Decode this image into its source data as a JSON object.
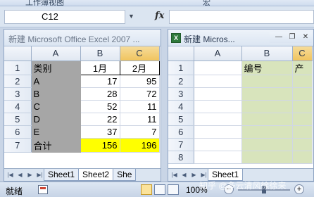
{
  "ribbon": {
    "group1": "工作簿视图",
    "group2": "宏"
  },
  "formula_bar": {
    "name_box": "C12",
    "fx": "fx"
  },
  "window_left": {
    "title": "新建 Microsoft Office Excel 2007 ...",
    "col_a": "A",
    "col_b": "B",
    "col_c": "C",
    "rows": [
      {
        "n": "1",
        "a": "类别",
        "b": "1月",
        "c": "2月"
      },
      {
        "n": "2",
        "a": "A",
        "b": "17",
        "c": "95"
      },
      {
        "n": "3",
        "a": "B",
        "b": "28",
        "c": "72"
      },
      {
        "n": "4",
        "a": "C",
        "b": "52",
        "c": "11"
      },
      {
        "n": "5",
        "a": "D",
        "b": "22",
        "c": "11"
      },
      {
        "n": "6",
        "a": "E",
        "b": "37",
        "c": "7"
      },
      {
        "n": "7",
        "a": "合计",
        "b": "156",
        "c": "196"
      }
    ],
    "tabs": [
      "Sheet1",
      "Sheet2",
      "She"
    ]
  },
  "window_right": {
    "title": "新建 Micros...",
    "col_a": "A",
    "col_b": "B",
    "col_c": "C",
    "rows": [
      {
        "n": "1",
        "b": "编号",
        "c": "产"
      },
      {
        "n": "2"
      },
      {
        "n": "3"
      },
      {
        "n": "4"
      },
      {
        "n": "5"
      },
      {
        "n": "6"
      },
      {
        "n": "7"
      },
      {
        "n": "8"
      }
    ],
    "tabs": [
      "Sheet1"
    ]
  },
  "status": {
    "mode": "就绪",
    "zoom": "100%",
    "zoom_minus": "−",
    "zoom_plus": "+"
  },
  "watermark": "知乎 @多云清风徐徐来"
}
